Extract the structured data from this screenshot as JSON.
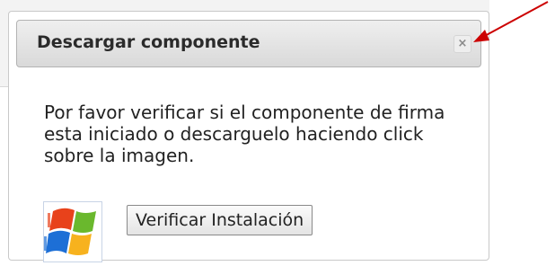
{
  "dialog": {
    "title": "Descargar componente",
    "close_label": "×",
    "message": "Por favor verificar si el componente de firma esta iniciado o descarguelo haciendo click sobre la imagen.",
    "verify_button_label": "Verificar Instalación",
    "installer_icon": "windows-logo-icon"
  },
  "annotation": {
    "color": "#cc0000",
    "icon": "red-arrow-icon"
  }
}
